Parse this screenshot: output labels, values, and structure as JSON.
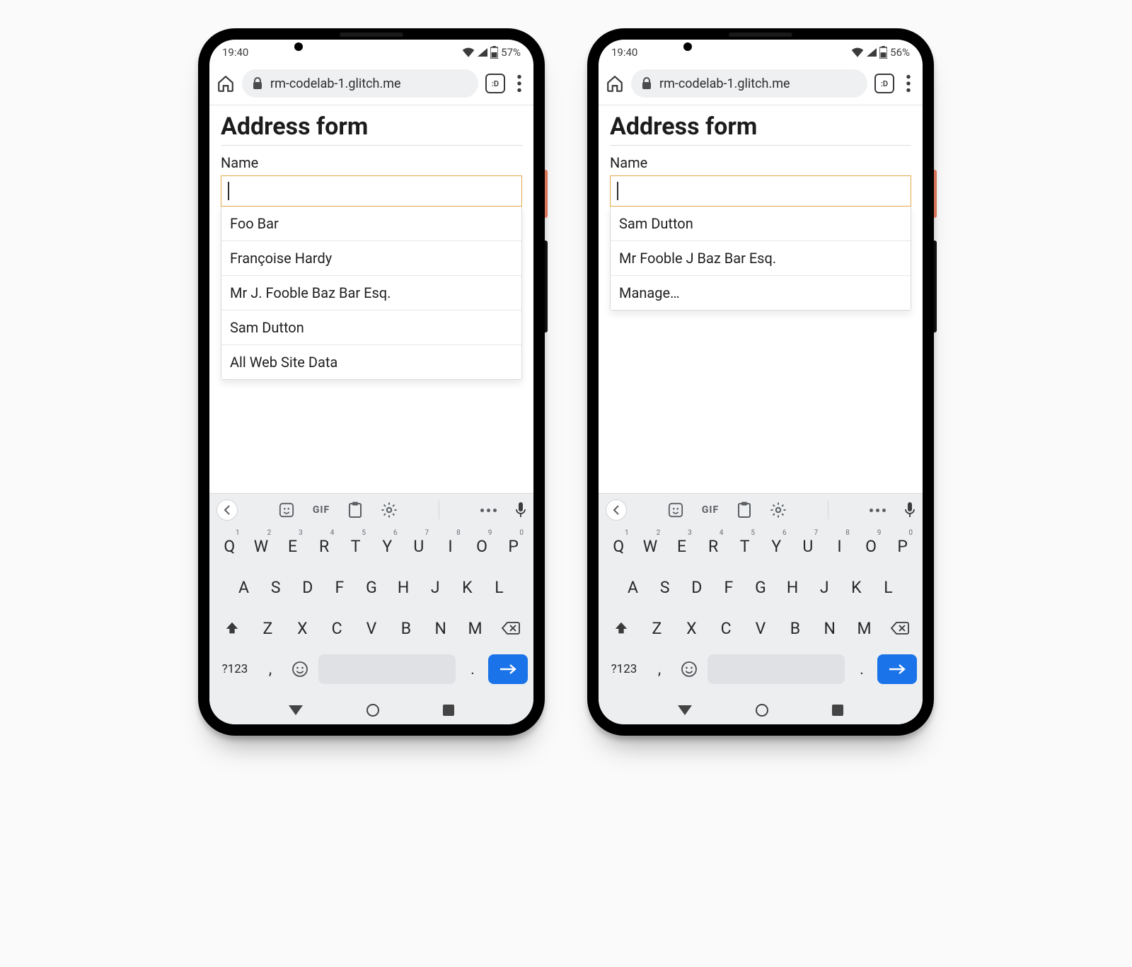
{
  "phones": [
    {
      "status": {
        "time": "19:40",
        "battery_text": "57%"
      },
      "browser": {
        "url_text": "rm-codelab-1.glitch.me",
        "tab_label": ":D"
      },
      "page": {
        "heading": "Address form",
        "field_label": "Name",
        "input_value": "",
        "suggestions": [
          "Foo Bar",
          "Françoise Hardy",
          "Mr J. Fooble Baz Bar Esq.",
          "Sam Dutton",
          "All Web Site Data"
        ]
      }
    },
    {
      "status": {
        "time": "19:40",
        "battery_text": "56%"
      },
      "browser": {
        "url_text": "rm-codelab-1.glitch.me",
        "tab_label": ":D"
      },
      "page": {
        "heading": "Address form",
        "field_label": "Name",
        "input_value": "",
        "suggestions": [
          "Sam Dutton",
          "Mr Fooble J Baz Bar Esq.",
          "Manage…"
        ]
      }
    }
  ],
  "keyboard": {
    "toolbar_gif": "GIF",
    "row1": [
      {
        "k": "Q",
        "n": "1"
      },
      {
        "k": "W",
        "n": "2"
      },
      {
        "k": "E",
        "n": "3"
      },
      {
        "k": "R",
        "n": "4"
      },
      {
        "k": "T",
        "n": "5"
      },
      {
        "k": "Y",
        "n": "6"
      },
      {
        "k": "U",
        "n": "7"
      },
      {
        "k": "I",
        "n": "8"
      },
      {
        "k": "O",
        "n": "9"
      },
      {
        "k": "P",
        "n": "0"
      }
    ],
    "row2": [
      "A",
      "S",
      "D",
      "F",
      "G",
      "H",
      "J",
      "K",
      "L"
    ],
    "row3": [
      "Z",
      "X",
      "C",
      "V",
      "B",
      "N",
      "M"
    ],
    "sym_label": "?123",
    "comma": ",",
    "dot": "."
  }
}
